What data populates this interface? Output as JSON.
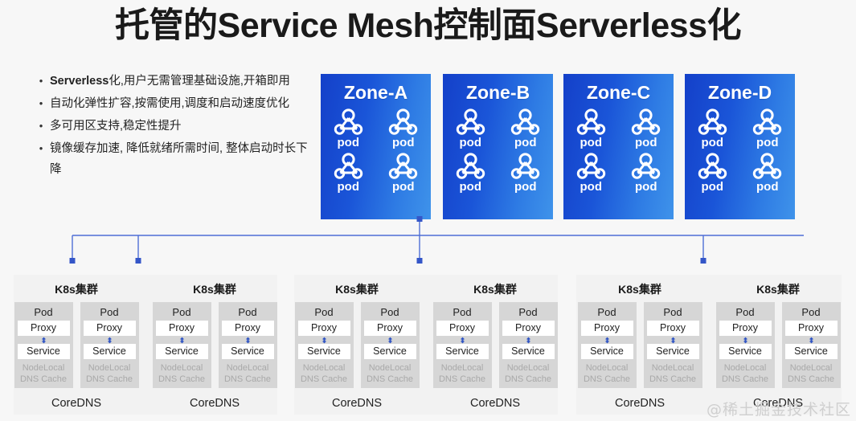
{
  "slide": {
    "title": "托管的Service Mesh控制面Serverless化",
    "background_color": "#f7f7f7",
    "watermark": "@稀土掘金技术社区"
  },
  "bullets": [
    {
      "bold_prefix": "Serverless",
      "text": "化,用户无需管理基础设施,开箱即用"
    },
    {
      "bold_prefix": "",
      "text": "自动化弹性扩容,按需使用,调度和启动速度优化"
    },
    {
      "bold_prefix": "",
      "text": "多可用区支持,稳定性提升"
    },
    {
      "bold_prefix": "",
      "text": "镜像缓存加速, 降低就绪所需时间, 整体启动时长下降"
    }
  ],
  "bullet_marker": "•",
  "zones": [
    {
      "title": "Zone-A",
      "pods": [
        "pod",
        "pod",
        "pod",
        "pod"
      ]
    },
    {
      "title": "Zone-B",
      "pods": [
        "pod",
        "pod",
        "pod",
        "pod"
      ]
    },
    {
      "title": "Zone-C",
      "pods": [
        "pod",
        "pod",
        "pod",
        "pod"
      ]
    },
    {
      "title": "Zone-D",
      "pods": [
        "pod",
        "pod",
        "pod",
        "pod"
      ]
    }
  ],
  "cluster_labels": {
    "title": "K8s集群",
    "pod": "Pod",
    "proxy": "Proxy",
    "service": "Service",
    "cache_line1": "NodeLocal",
    "cache_line2": "DNS Cache",
    "coredns": "CoreDNS"
  },
  "clusters": [
    {
      "title": "K8s集群",
      "coredns": "CoreDNS",
      "columns": [
        {
          "pod": "Pod",
          "proxy": "Proxy",
          "service": "Service",
          "cache": "NodeLocal DNS Cache"
        },
        {
          "pod": "Pod",
          "proxy": "Proxy",
          "service": "Service",
          "cache": "NodeLocal DNS Cache"
        }
      ]
    },
    {
      "title": "K8s集群",
      "coredns": "CoreDNS",
      "columns": [
        {
          "pod": "Pod",
          "proxy": "Proxy",
          "service": "Service",
          "cache": "NodeLocal DNS Cache"
        },
        {
          "pod": "Pod",
          "proxy": "Proxy",
          "service": "Service",
          "cache": "NodeLocal DNS Cache"
        }
      ]
    },
    {
      "title": "K8s集群",
      "coredns": "CoreDNS",
      "columns": [
        {
          "pod": "Pod",
          "proxy": "Proxy",
          "service": "Service",
          "cache": "NodeLocal DNS Cache"
        },
        {
          "pod": "Pod",
          "proxy": "Proxy",
          "service": "Service",
          "cache": "NodeLocal DNS Cache"
        }
      ]
    },
    {
      "title": "K8s集群",
      "coredns": "CoreDNS",
      "columns": [
        {
          "pod": "Pod",
          "proxy": "Proxy",
          "service": "Service",
          "cache": "NodeLocal DNS Cache"
        },
        {
          "pod": "Pod",
          "proxy": "Proxy",
          "service": "Service",
          "cache": "NodeLocal DNS Cache"
        }
      ]
    },
    {
      "title": "K8s集群",
      "coredns": "CoreDNS",
      "columns": [
        {
          "pod": "Pod",
          "proxy": "Proxy",
          "service": "Service",
          "cache": "NodeLocal DNS Cache"
        },
        {
          "pod": "Pod",
          "proxy": "Proxy",
          "service": "Service",
          "cache": "NodeLocal DNS Cache"
        }
      ]
    },
    {
      "title": "K8s集群",
      "coredns": "CoreDNS",
      "columns": [
        {
          "pod": "Pod",
          "proxy": "Proxy",
          "service": "Service",
          "cache": "NodeLocal DNS Cache"
        },
        {
          "pod": "Pod",
          "proxy": "Proxy",
          "service": "Service",
          "cache": "NodeLocal DNS Cache"
        }
      ]
    }
  ],
  "colors": {
    "zone_gradient_start": "#1440c9",
    "zone_gradient_end": "#3f93ea",
    "connector_line": "#4f6fd6",
    "cluster_bg": "#f2f2f2",
    "pod_column_bg": "#d6d6d6",
    "cache_text": "#a9a9a9",
    "title_text": "#1a1a1a",
    "watermark_text": "#cfcfcf"
  },
  "icons": {
    "pod": "pod-node-graph-icon",
    "proxy_service_link": "double-arrow-icon"
  }
}
